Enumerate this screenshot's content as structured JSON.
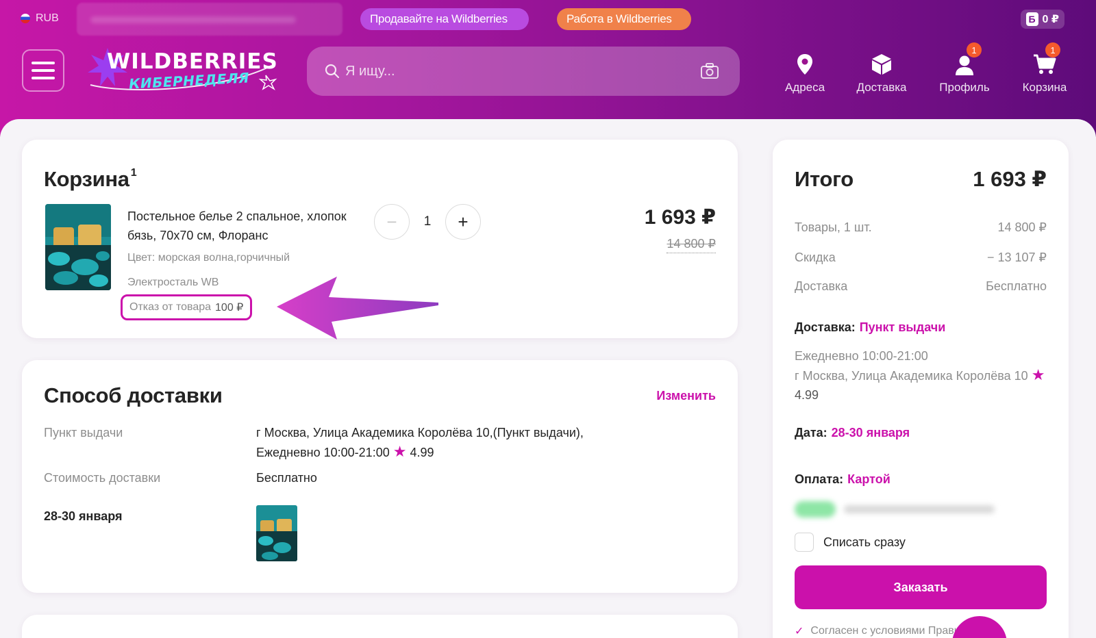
{
  "header": {
    "currency": "RUB",
    "sell_pill": "Продавайте на Wildberries",
    "work_pill": "Работа в Wildberries",
    "balance": "0 ₽",
    "balance_icon": "Б",
    "logo_main": "WILDBERRIES",
    "logo_sub": "КИБЕРНЕДЕЛЯ",
    "search_placeholder": "Я ищу...",
    "nav": [
      {
        "label": "Адреса",
        "icon": "map-pin-icon"
      },
      {
        "label": "Доставка",
        "icon": "box-icon"
      },
      {
        "label": "Профиль",
        "icon": "user-icon",
        "badge": "1"
      },
      {
        "label": "Корзина",
        "icon": "cart-icon",
        "badge": "1"
      }
    ],
    "colors": {
      "brand": "#cb11ab",
      "sell_pill": "#b94be0",
      "work_pill": "#f0814a",
      "badge": "#f55a2c"
    }
  },
  "cart": {
    "title": "Корзина",
    "count": "1",
    "product": {
      "name": "Постельное белье 2 спальное, хлопок бязь, 70х70 см, Флоранс",
      "color": "Цвет: морская волна,горчичный",
      "seller": "Электросталь WB",
      "refusal_label": "Отказ от товара",
      "refusal_price": "100 ₽",
      "quantity": "1",
      "price": "1 693 ₽",
      "old_price": "14 800 ₽"
    }
  },
  "delivery": {
    "title": "Способ доставки",
    "change": "Изменить",
    "pickup_label": "Пункт выдачи",
    "pickup_value_1": "г Москва, Улица Академика Королёва 10,(Пункт выдачи),",
    "pickup_value_2": "Ежедневно 10:00-21:00",
    "rating": "4.99",
    "cost_label": "Стоимость доставки",
    "cost_value": "Бесплатно",
    "date": "28-30 января"
  },
  "totals": {
    "title": "Итого",
    "sum": "1 693 ₽",
    "goods_label": "Товары, 1 шт.",
    "goods_value": "14 800 ₽",
    "discount_label": "Скидка",
    "discount_value": "− 13 107 ₽",
    "shipping_label": "Доставка",
    "shipping_value": "Бесплатно",
    "delivery_label": "Доставка:",
    "delivery_value": "Пункт выдачи",
    "hours": "Ежедневно 10:00-21:00",
    "address": "г Москва, Улица Академика Королёва 10",
    "rating": "4.99",
    "date_label": "Дата:",
    "date_value": "28-30 января",
    "payment_label": "Оплата:",
    "payment_value": "Картой",
    "charge_now": "Списать сразу",
    "order_button": "Заказать",
    "agree": "Согласен с условиями Правил"
  }
}
